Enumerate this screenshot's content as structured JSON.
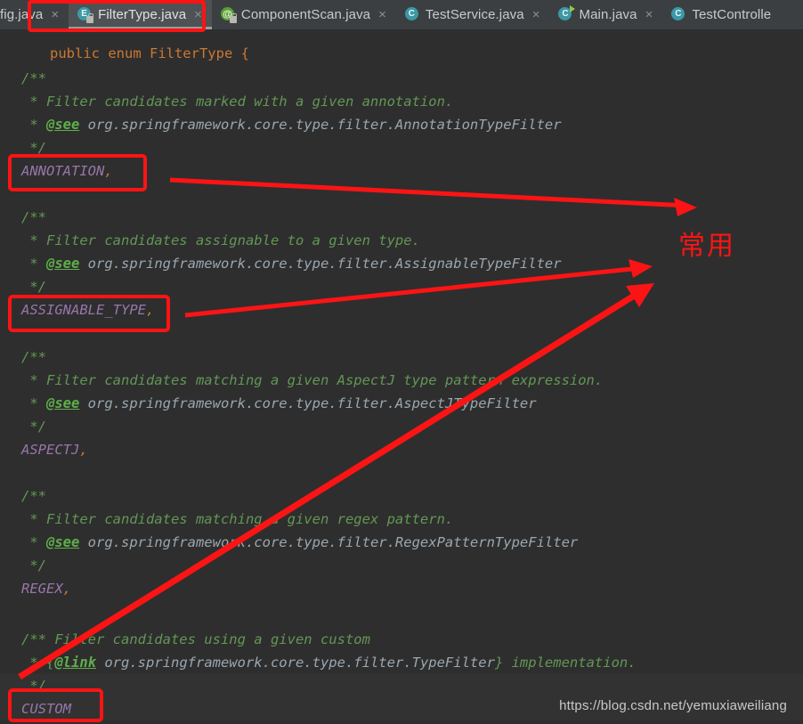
{
  "window": {
    "app": "IntelliJ IDEA Editor",
    "file_clipped_line": "public enum FilterType {"
  },
  "tabs": [
    {
      "label": "fig.java",
      "icon": "java-class-icon",
      "selected": false,
      "close": "×",
      "truncated_left": true
    },
    {
      "label": "FilterType.java",
      "icon": "java-enum-icon",
      "selected": true,
      "close": "×"
    },
    {
      "label": "ComponentScan.java",
      "icon": "java-annotation-icon",
      "selected": false,
      "close": "×"
    },
    {
      "label": "TestService.java",
      "icon": "java-class-icon",
      "selected": false,
      "close": "×"
    },
    {
      "label": "Main.java",
      "icon": "java-runnable-class-icon",
      "selected": false,
      "close": "×"
    },
    {
      "label": "TestControlle",
      "icon": "java-class-icon",
      "selected": false,
      "close": "",
      "truncated_right": true
    }
  ],
  "code": {
    "blocks": [
      {
        "open": "/**",
        "desc": " * Filter candidates marked with a given annotation.",
        "tag": " * ",
        "tag_name": "@see",
        "tag_ref": " org.springframework.core.type.filter.AnnotationTypeFilter",
        "close": " */",
        "constant": "ANNOTATION",
        "comma": ",",
        "boxed": true
      },
      {
        "open": "/**",
        "desc": " * Filter candidates assignable to a given type.",
        "tag": " * ",
        "tag_name": "@see",
        "tag_ref": " org.springframework.core.type.filter.AssignableTypeFilter",
        "close": " */",
        "constant": "ASSIGNABLE_TYPE",
        "comma": ",",
        "boxed": true
      },
      {
        "open": "/**",
        "desc": " * Filter candidates matching a given AspectJ type pattern expression.",
        "tag": " * ",
        "tag_name": "@see",
        "tag_ref": " org.springframework.core.type.filter.AspectJTypeFilter",
        "close": " */",
        "constant": "ASPECTJ",
        "comma": ",",
        "boxed": false
      },
      {
        "open": "/**",
        "desc": " * Filter candidates matching a given regex pattern.",
        "tag": " * ",
        "tag_name": "@see",
        "tag_ref": " org.springframework.core.type.filter.RegexPatternTypeFilter",
        "close": " */",
        "constant": "REGEX",
        "comma": ",",
        "boxed": false
      }
    ],
    "last_block": {
      "open": "/** Filter candidates using a given custom",
      "tag": " * {",
      "tag_name": "@link",
      "tag_ref": " org.springframework.core.type.filter.TypeFilter",
      "tag_tail": "} implementation.",
      "close": " */",
      "constant": "CUSTOM",
      "boxed": true
    }
  },
  "annotations": {
    "note_cjk": "常用",
    "color_red": "#fc1414",
    "box_color": "#fc1414"
  },
  "watermark": {
    "text": "https://blog.csdn.net/yemuxiaweiliang"
  },
  "theme": {
    "editor_bg": "#2e2e2e",
    "tabbar_bg": "#3c3f41",
    "selected_tab_bg": "#4e5254",
    "comment": "#629755",
    "javadoc_tag": "#5fae4a",
    "javadoc_ref": "#9aa7b0",
    "enum_const": "#9876aa",
    "punctuation": "#cc7832"
  }
}
